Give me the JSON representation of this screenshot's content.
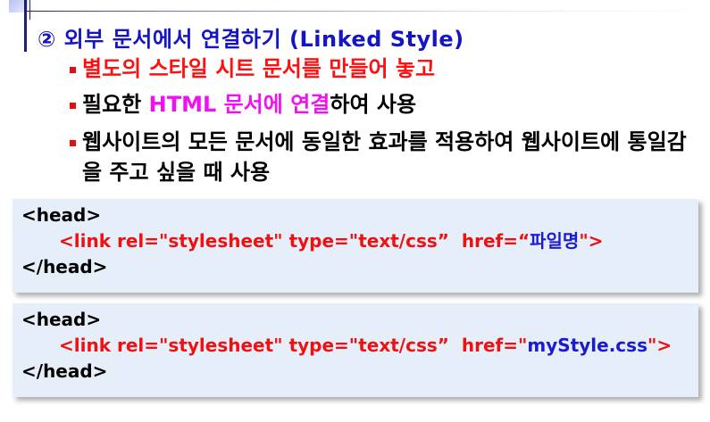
{
  "heading": "② 외부 문서에서 연결하기 (Linked Style)",
  "bullets": {
    "b1": "별도의 스타일 시트 문서를 만들어 놓고",
    "b2_before": "필요한 ",
    "b2_highlight": "HTML 문서에 연결",
    "b2_after": "하여 사용",
    "b3": "웹사이트의 모든 문서에 동일한 효과를 적용하여 웹사이트에  통일감을 주고 싶을 때 사용"
  },
  "code_block_1": {
    "open_tag": "<head>",
    "link_prefix": "<link rel=\"stylesheet\" type=\"text/css”  href=“",
    "link_value": "파일명",
    "link_suffix": "\">",
    "close_tag": "</head>"
  },
  "code_block_2": {
    "open_tag": "<head>",
    "link_prefix": "<link rel=\"stylesheet\" type=\"text/css”  href=\"",
    "link_value": "myStyle.css",
    "link_suffix": "\">",
    "close_tag": "</head>"
  },
  "colors": {
    "heading": "#1515c8",
    "bullet_red": "#ff1010",
    "bullet_magenta": "#f010f0",
    "code_tag_red": "#ee1111",
    "code_value_blue": "#1a1ad0",
    "code_box_bg": "#e6eefa"
  }
}
